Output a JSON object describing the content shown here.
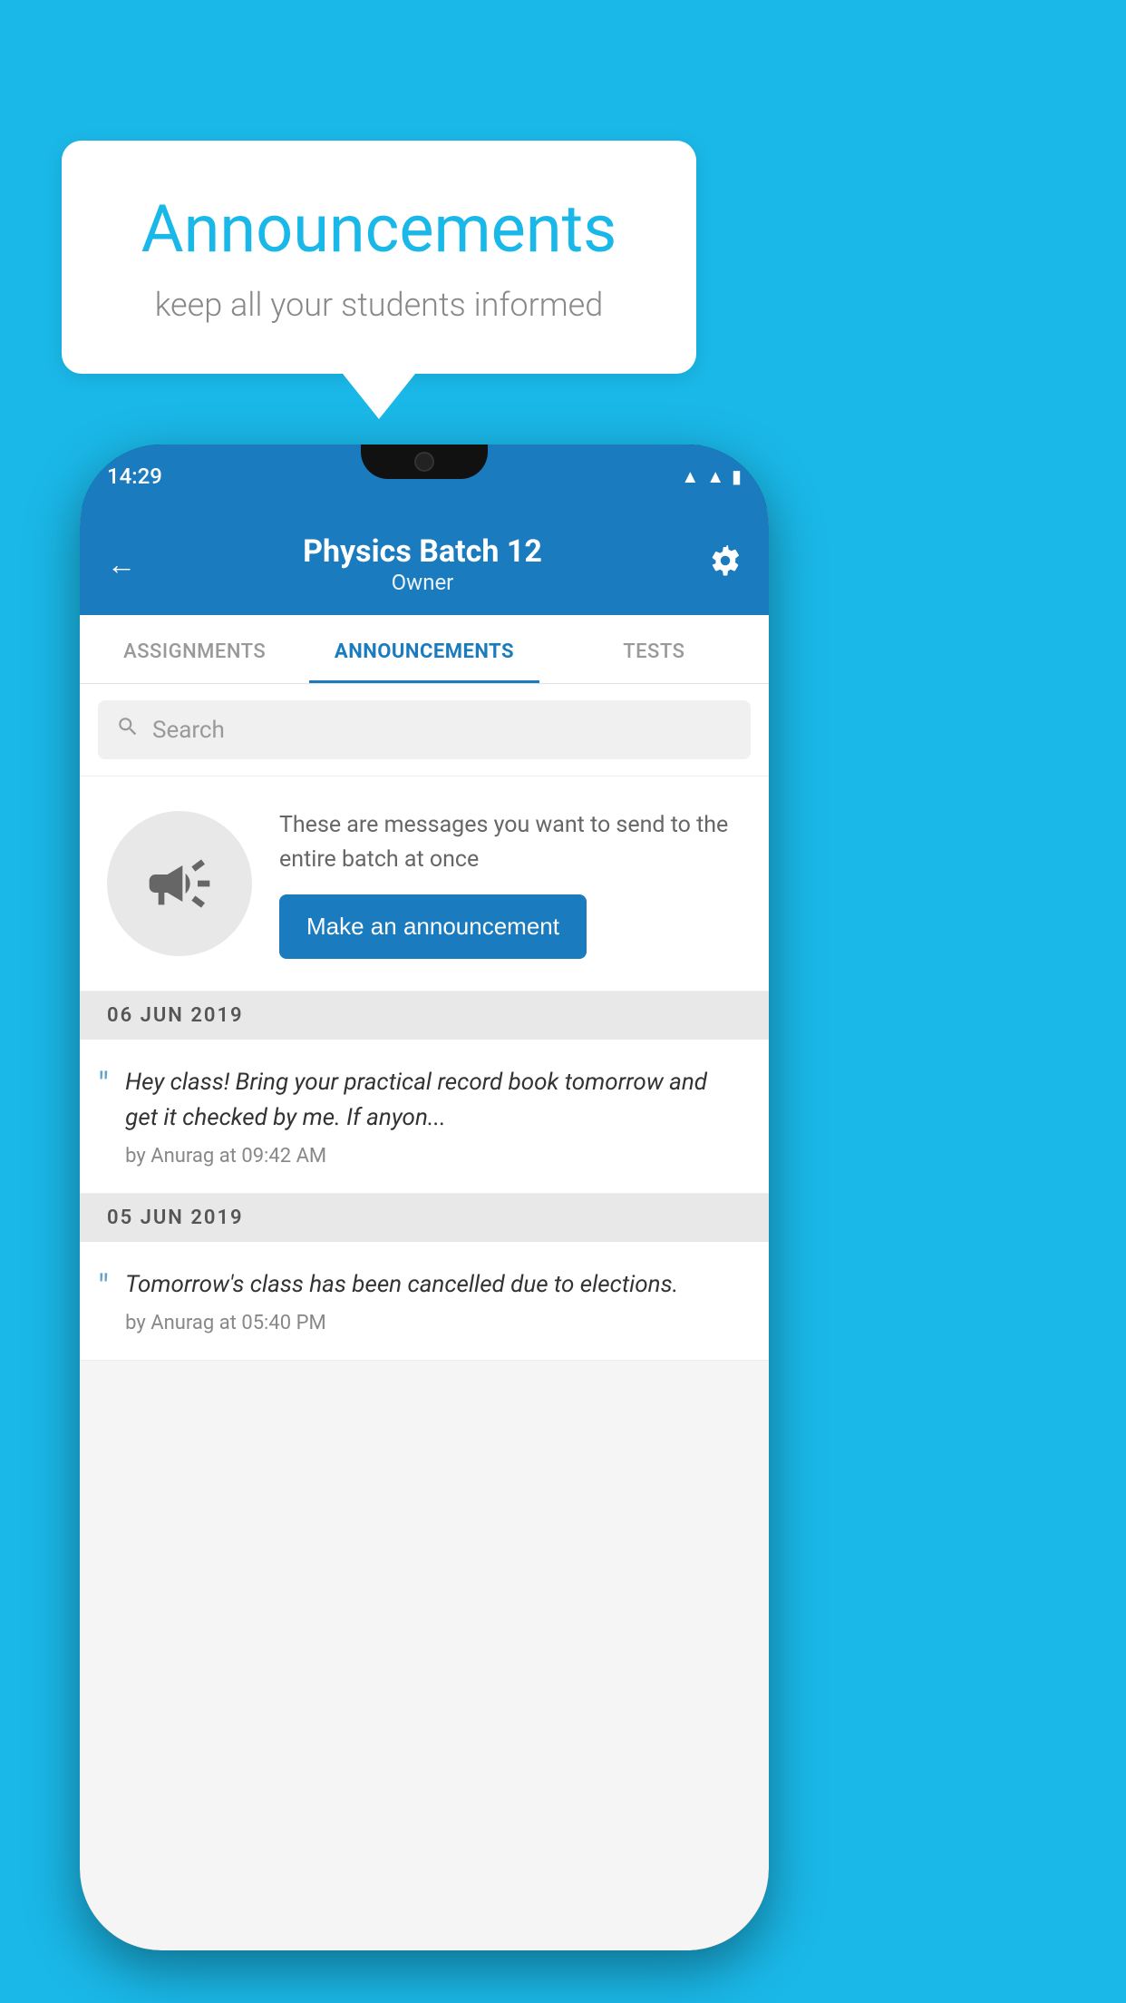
{
  "background_color": "#1ab8e8",
  "speech_bubble": {
    "title": "Announcements",
    "subtitle": "keep all your students informed"
  },
  "phone": {
    "status_bar": {
      "time": "14:29"
    },
    "header": {
      "title": "Physics Batch 12",
      "subtitle": "Owner",
      "back_label": "←",
      "settings_label": "⚙"
    },
    "tabs": [
      {
        "label": "ASSIGNMENTS",
        "active": false
      },
      {
        "label": "ANNOUNCEMENTS",
        "active": true
      },
      {
        "label": "TESTS",
        "active": false
      },
      {
        "label": "...",
        "active": false
      }
    ],
    "search": {
      "placeholder": "Search"
    },
    "promo": {
      "description": "These are messages you want to send to the entire batch at once",
      "button_label": "Make an announcement"
    },
    "announcements": [
      {
        "date": "06  JUN  2019",
        "items": [
          {
            "text": "Hey class! Bring your practical record book tomorrow and get it checked by me. If anyon...",
            "meta": "by Anurag at 09:42 AM"
          }
        ]
      },
      {
        "date": "05  JUN  2019",
        "items": [
          {
            "text": "Tomorrow's class has been cancelled due to elections.",
            "meta": "by Anurag at 05:40 PM"
          }
        ]
      }
    ]
  }
}
